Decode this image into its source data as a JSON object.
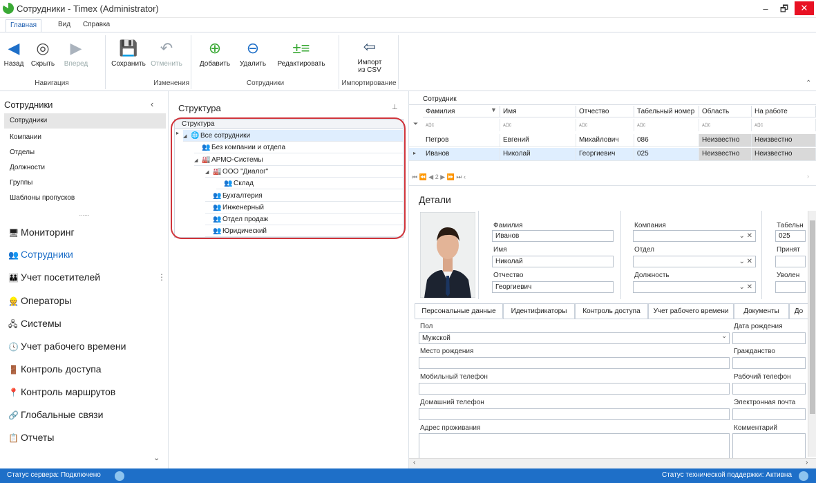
{
  "window": {
    "title": "Сотрудники - Timex (Administrator)",
    "minimize": "–",
    "restore": "🗗",
    "close": "✕"
  },
  "menu": {
    "tabs": [
      "Главная",
      "Вид",
      "Справка"
    ]
  },
  "ribbon": {
    "buttons": {
      "back": "Назад",
      "hide": "Скрыть",
      "forward": "Вперед",
      "save": "Сохранить",
      "undo": "Отменить",
      "add": "Добавить",
      "delete": "Удалить",
      "edit": "Редактировать",
      "import_line1": "Импорт",
      "import_line2": "из CSV"
    },
    "groups": {
      "navigation": "Навигация",
      "changes": "Изменения",
      "employees": "Сотрудники",
      "import": "Импортирование"
    }
  },
  "nav": {
    "header": "Сотрудники",
    "sub_items": [
      "Сотрудники",
      "Компании",
      "Отделы",
      "Должности",
      "Группы",
      "Шаблоны пропусков"
    ],
    "dots": "......",
    "big_items": [
      {
        "label": "Мониторинг",
        "icon": "monitor-icon",
        "glyph": "🖥"
      },
      {
        "label": "Сотрудники",
        "icon": "employees-icon",
        "glyph": "👥"
      },
      {
        "label": "Учет посетителей",
        "icon": "visitors-icon",
        "glyph": "👪"
      },
      {
        "label": "Операторы",
        "icon": "operators-icon",
        "glyph": "👷"
      },
      {
        "label": "Системы",
        "icon": "systems-icon",
        "glyph": "🖧"
      },
      {
        "label": "Учет рабочего времени",
        "icon": "clock-icon",
        "glyph": "🕓"
      },
      {
        "label": "Контроль доступа",
        "icon": "door-icon",
        "glyph": "🚪"
      },
      {
        "label": "Контроль маршрутов",
        "icon": "route-icon",
        "glyph": "📍"
      },
      {
        "label": "Глобальные связи",
        "icon": "link-icon",
        "glyph": "🔗"
      },
      {
        "label": "Отчеты",
        "icon": "reports-icon",
        "glyph": "📋"
      }
    ]
  },
  "structure": {
    "title": "Структура",
    "pin": "⊥",
    "tree_header": "Структура",
    "nodes": [
      {
        "label": "Все сотрудники",
        "indent": 0,
        "icon": "globe-icon",
        "glyph": "🌐",
        "expander": "◢"
      },
      {
        "label": "Без компании и отдела",
        "indent": 1,
        "icon": "group-icon",
        "glyph": "👥",
        "expander": ""
      },
      {
        "label": "АРМО-Системы",
        "indent": 1,
        "icon": "company-icon",
        "glyph": "🏭",
        "expander": "◢"
      },
      {
        "label": "ООО \"Диалог\"",
        "indent": 2,
        "icon": "company-icon",
        "glyph": "🏭",
        "expander": "◢"
      },
      {
        "label": "Склад",
        "indent": 3,
        "icon": "group-icon",
        "glyph": "👥",
        "expander": ""
      },
      {
        "label": "Бухгалтерия",
        "indent": 2,
        "icon": "group-icon",
        "glyph": "👥",
        "expander": ""
      },
      {
        "label": "Инженерный",
        "indent": 2,
        "icon": "group-icon",
        "glyph": "👥",
        "expander": ""
      },
      {
        "label": "Отдел продаж",
        "indent": 2,
        "icon": "group-icon",
        "glyph": "👥",
        "expander": ""
      },
      {
        "label": "Юридический",
        "indent": 2,
        "icon": "group-icon",
        "glyph": "👥",
        "expander": ""
      }
    ]
  },
  "grid": {
    "band": "Сотрудник",
    "columns": [
      "Фамилия",
      "Имя",
      "Отчество",
      "Табельный номер",
      "Область",
      "На работе"
    ],
    "filter_glyph": "ᴀ▯c",
    "rows": [
      [
        "Петров",
        "Евгений",
        "Михайлович",
        "086",
        "Неизвестно",
        "Неизвестно"
      ],
      [
        "Иванов",
        "Николай",
        "Георгиевич",
        "025",
        "Неизвестно",
        "Неизвестно"
      ]
    ],
    "pager": "⏮ ⏪ ◀ 2 ▶ ⏩ ⏭ ‹"
  },
  "details": {
    "title": "Детали",
    "fields": {
      "last_name_label": "Фамилия",
      "last_name": "Иванов",
      "first_name_label": "Имя",
      "first_name": "Николай",
      "patronymic_label": "Отчество",
      "patronymic": "Георгиевич",
      "company_label": "Компания",
      "department_label": "Отдел",
      "position_label": "Должность",
      "tab_num_label": "Табельн",
      "tab_num": "025",
      "hired_label": "Принят",
      "fired_label": "Уволен"
    },
    "tabs": [
      "Персональные данные",
      "Идентификаторы",
      "Контроль доступа",
      "Учет рабочего времени",
      "Документы",
      "До"
    ],
    "personal": {
      "gender_label": "Пол",
      "gender": "Мужской",
      "birth_date_label": "Дата рождения",
      "birth_place_label": "Место рождения",
      "citizenship_label": "Гражданство",
      "mobile_label": "Мобильный телефон",
      "work_phone_label": "Рабочий телефон",
      "home_phone_label": "Домашний телефон",
      "email_label": "Электронная почта",
      "address_label": "Адрес проживания",
      "comment_label": "Комментарий"
    }
  },
  "status": {
    "server": "Статус сервера: Подключено",
    "support": "Статус технической поддержки: Активна"
  },
  "colors": {
    "accent": "#1e6fc8",
    "highlight": "#d0343b",
    "selected_row": "#dfeefe"
  }
}
